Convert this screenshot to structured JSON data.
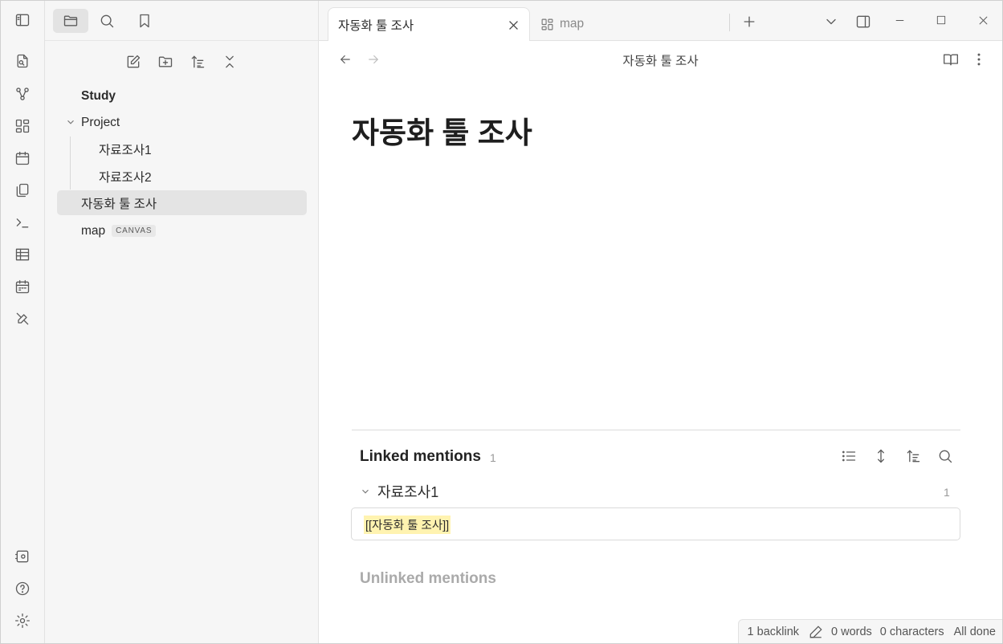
{
  "sidebar": {
    "tree": {
      "study": "Study",
      "project": "Project",
      "child1": "자료조사1",
      "child2": "자료조사2",
      "automation": "자동화 툴 조사",
      "map": "map",
      "map_badge": "CANVAS"
    }
  },
  "tabs": [
    {
      "label": "자동화 툴 조사"
    },
    {
      "label": "map"
    }
  ],
  "editor": {
    "nav_title": "자동화 툴 조사",
    "doc_title": "자동화 툴 조사"
  },
  "backlinks": {
    "linked_title": "Linked mentions",
    "linked_count": "1",
    "file_name": "자료조사1",
    "file_count": "1",
    "mention_text": "[[자동화 툴 조사]]",
    "unlinked_title": "Unlinked mentions"
  },
  "status": {
    "backlinks": "1 backlink",
    "words": "0 words",
    "characters": "0 characters",
    "sync": "All done"
  }
}
